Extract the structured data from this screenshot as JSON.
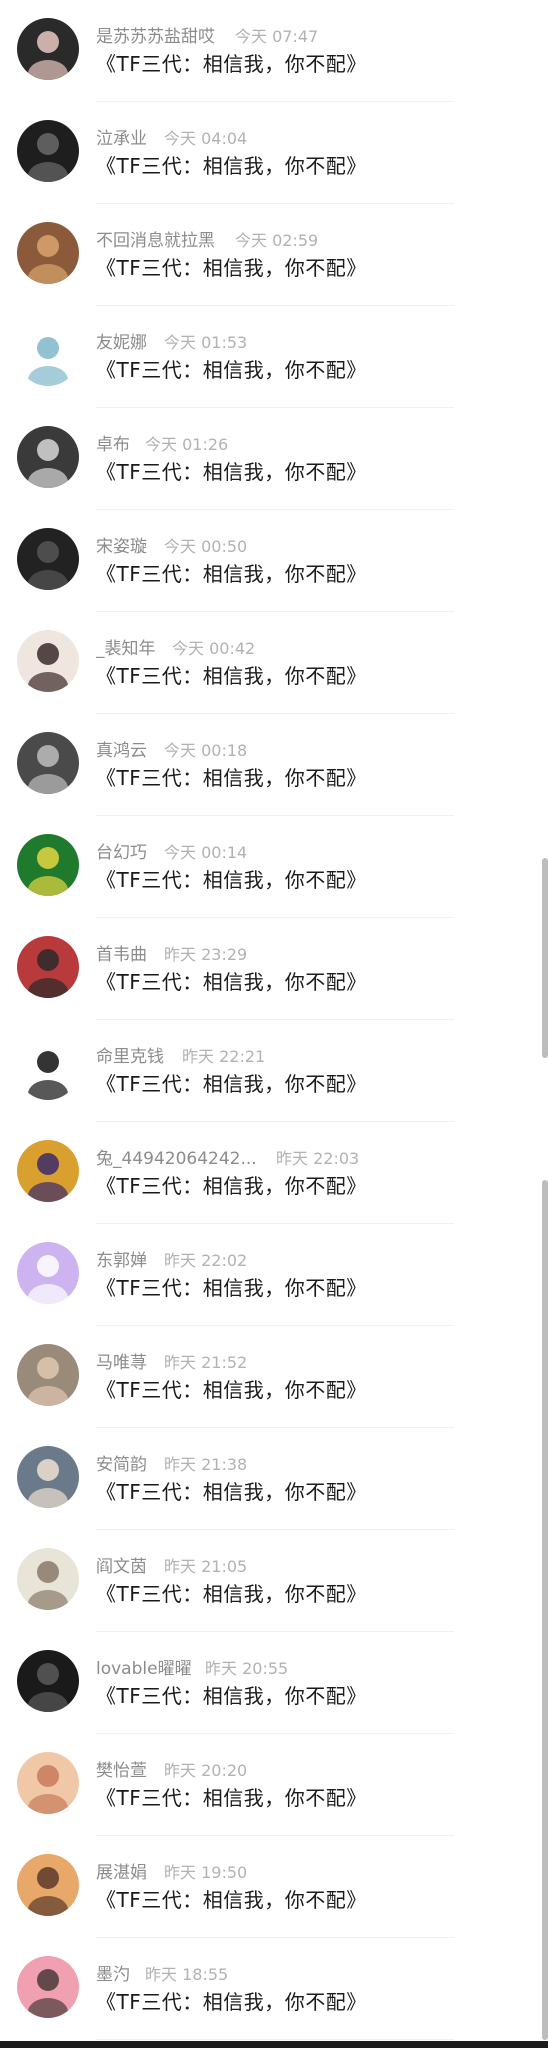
{
  "comments": [
    {
      "name": "是苏苏苏盐甜哎",
      "time": "今天 07:47",
      "message": "《TF三代：相信我，你不配》",
      "avatar_color": "#2a2a2a",
      "avatar_accent": "#e8c8c0"
    },
    {
      "name": "泣承业",
      "time": "今天 04:04",
      "message": "《TF三代：相信我，你不配》",
      "avatar_color": "#1e1e1e",
      "avatar_accent": "#6a6a6a"
    },
    {
      "name": "不回消息就拉黑",
      "time": "今天 02:59",
      "message": "《TF三代：相信我，你不配》",
      "avatar_color": "#8a5a3a",
      "avatar_accent": "#d9a46e"
    },
    {
      "name": "友妮娜",
      "time": "今天 01:53",
      "message": "《TF三代：相信我，你不配》",
      "avatar_color": "#ffffff",
      "avatar_accent": "#7fb7c9"
    },
    {
      "name": "卓布",
      "time": "今天 01:26",
      "message": "《TF三代：相信我，你不配》",
      "avatar_color": "#3a3a3a",
      "avatar_accent": "#d8d8d8"
    },
    {
      "name": "宋姿璇",
      "time": "今天 00:50",
      "message": "《TF三代：相信我，你不配》",
      "avatar_color": "#222222",
      "avatar_accent": "#555555"
    },
    {
      "name": "_裴知年",
      "time": "今天 00:42",
      "message": "《TF三代：相信我，你不配》",
      "avatar_color": "#f0e6e0",
      "avatar_accent": "#3a2a2a"
    },
    {
      "name": "真鸿云",
      "time": "今天 00:18",
      "message": "《TF三代：相信我，你不配》",
      "avatar_color": "#4a4a4a",
      "avatar_accent": "#bdbdbd"
    },
    {
      "name": "台幻巧",
      "time": "今天 00:14",
      "message": "《TF三代：相信我，你不配》",
      "avatar_color": "#1f7a2e",
      "avatar_accent": "#e6d640"
    },
    {
      "name": "首韦曲",
      "time": "昨天 23:29",
      "message": "《TF三代：相信我，你不配》",
      "avatar_color": "#b83a3a",
      "avatar_accent": "#2a2a2a"
    },
    {
      "name": "命里克钱",
      "time": "昨天 22:21",
      "message": "《TF三代：相信我，你不配》",
      "avatar_color": "#ffffff",
      "avatar_accent": "#111111"
    },
    {
      "name": "兔_44942064242...",
      "time": "昨天 22:03",
      "message": "《TF三代：相信我，你不配》",
      "avatar_color": "#d9a030",
      "avatar_accent": "#3a2a6a"
    },
    {
      "name": "东郭婵",
      "time": "昨天 22:02",
      "message": "《TF三代：相信我，你不配》",
      "avatar_color": "#cdb4f0",
      "avatar_accent": "#ffffff"
    },
    {
      "name": "马唯荨",
      "time": "昨天 21:52",
      "message": "《TF三代：相信我，你不配》",
      "avatar_color": "#9a8a7a",
      "avatar_accent": "#e0c8b0"
    },
    {
      "name": "安简韵",
      "time": "昨天 21:38",
      "message": "《TF三代：相信我，你不配》",
      "avatar_color": "#6a7a8a",
      "avatar_accent": "#f0e0d0"
    },
    {
      "name": "阎文茵",
      "time": "昨天 21:05",
      "message": "《TF三代：相信我，你不配》",
      "avatar_color": "#e8e4d8",
      "avatar_accent": "#8a7a6a"
    },
    {
      "name": "lovable曜曜",
      "time": "昨天 20:55",
      "message": "《TF三代：相信我，你不配》",
      "avatar_color": "#1a1a1a",
      "avatar_accent": "#5a5a5a"
    },
    {
      "name": "樊怡萱",
      "time": "昨天 20:20",
      "message": "《TF三代：相信我，你不配》",
      "avatar_color": "#f0c8a8",
      "avatar_accent": "#c87a5a"
    },
    {
      "name": "展湛娟",
      "time": "昨天 19:50",
      "message": "《TF三代：相信我，你不配》",
      "avatar_color": "#e8a86a",
      "avatar_accent": "#5a3a2a"
    },
    {
      "name": "墨汋",
      "time": "昨天 18:55",
      "message": "《TF三代：相信我，你不配》",
      "avatar_color": "#f0a0b0",
      "avatar_accent": "#4a3a3a"
    }
  ],
  "scrollbar_color": "#bdbdbd"
}
